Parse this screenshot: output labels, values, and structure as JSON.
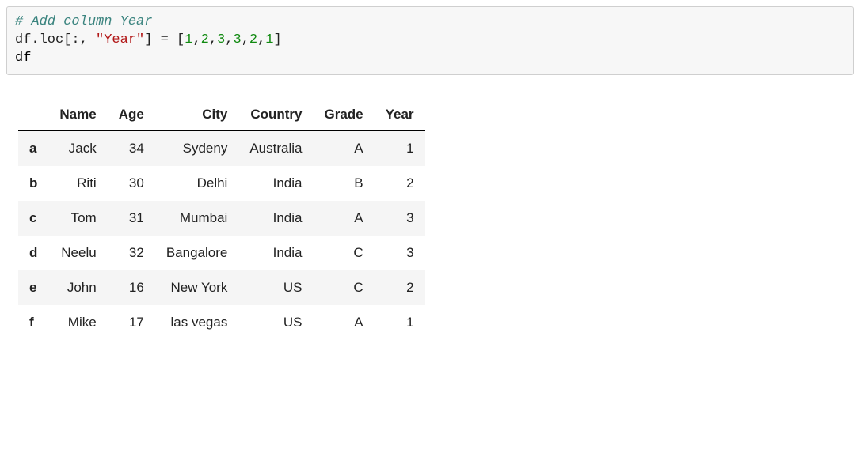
{
  "code": {
    "comment": "# Add column Year",
    "line2_pre": "df.loc[:, ",
    "line2_str": "\"Year\"",
    "line2_mid": "] = [",
    "nums": [
      "1",
      "2",
      "3",
      "3",
      "2",
      "1"
    ],
    "line2_end": "]",
    "line3": "df"
  },
  "chart_data": {
    "type": "table",
    "columns": [
      "Name",
      "Age",
      "City",
      "Country",
      "Grade",
      "Year"
    ],
    "index": [
      "a",
      "b",
      "c",
      "d",
      "e",
      "f"
    ],
    "rows": [
      {
        "Name": "Jack",
        "Age": 34,
        "City": "Sydeny",
        "Country": "Australia",
        "Grade": "A",
        "Year": 1
      },
      {
        "Name": "Riti",
        "Age": 30,
        "City": "Delhi",
        "Country": "India",
        "Grade": "B",
        "Year": 2
      },
      {
        "Name": "Tom",
        "Age": 31,
        "City": "Mumbai",
        "Country": "India",
        "Grade": "A",
        "Year": 3
      },
      {
        "Name": "Neelu",
        "Age": 32,
        "City": "Bangalore",
        "Country": "India",
        "Grade": "C",
        "Year": 3
      },
      {
        "Name": "John",
        "Age": 16,
        "City": "New York",
        "Country": "US",
        "Grade": "C",
        "Year": 2
      },
      {
        "Name": "Mike",
        "Age": 17,
        "City": "las vegas",
        "Country": "US",
        "Grade": "A",
        "Year": 1
      }
    ]
  }
}
